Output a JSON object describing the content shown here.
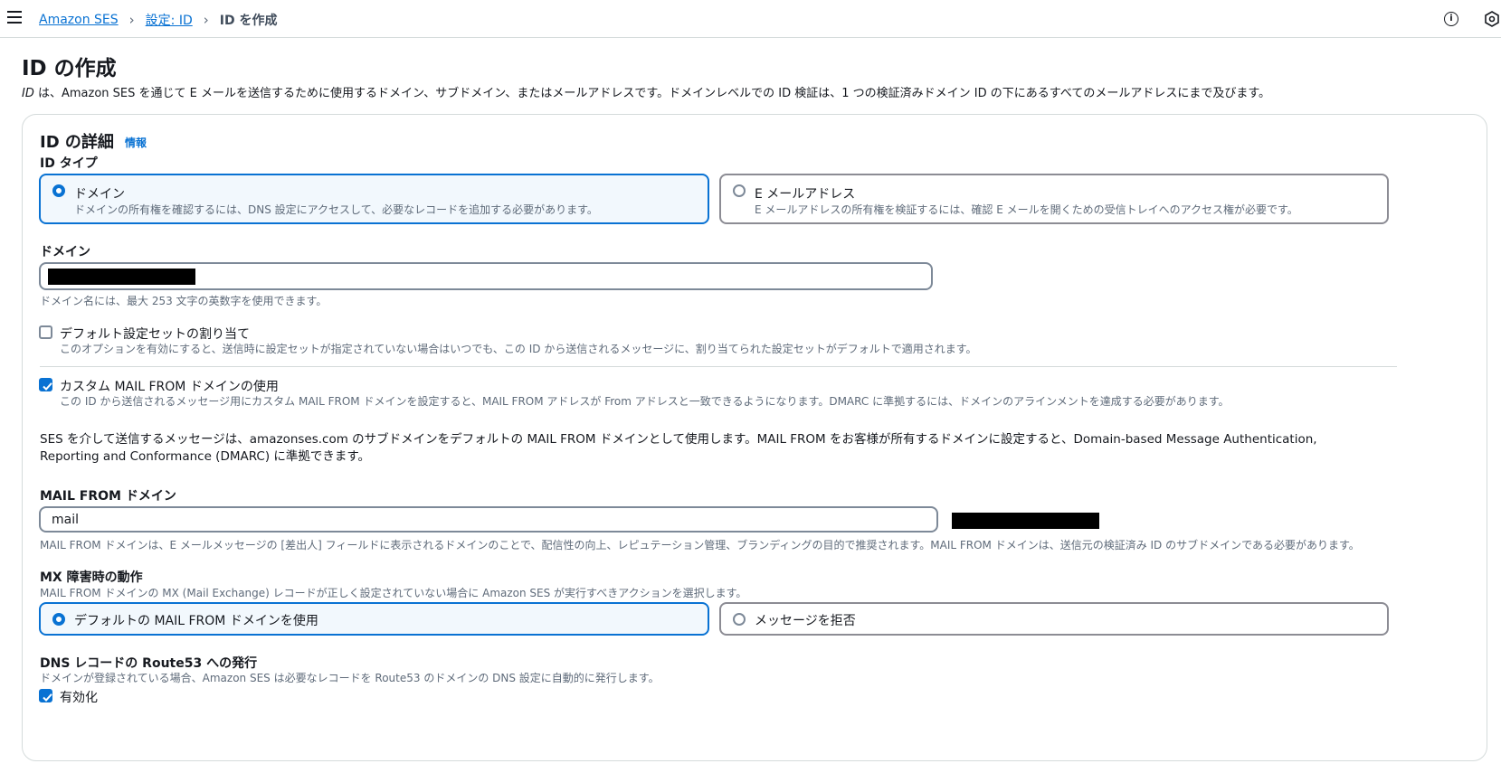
{
  "breadcrumb": {
    "items": [
      "Amazon SES",
      "設定: ID"
    ],
    "current": "ID を作成"
  },
  "icons": {
    "menu": "hamburger-icon",
    "info": "info-icon",
    "settings": "hexagon-icon"
  },
  "header": {
    "title": "ID の作成",
    "desc_em": "ID",
    "desc_rest": " は、Amazon SES を通じて E メールを送信するために使用するドメイン、サブドメイン、またはメールアドレスです。ドメインレベルでの ID 検証は、1 つの検証済みドメイン ID の下にあるすべてのメールアドレスにまで及びます。"
  },
  "details": {
    "title": "ID の詳細",
    "info_link": "情報",
    "id_type_label": "ID タイプ",
    "options": [
      {
        "title": "ドメイン",
        "desc": "ドメインの所有権を確認するには、DNS 設定にアクセスして、必要なレコードを追加する必要があります。",
        "selected": true
      },
      {
        "title": "E メールアドレス",
        "desc": "E メールアドレスの所有権を検証するには、確認 E メールを開くための受信トレイへのアクセス権が必要です。",
        "selected": false
      }
    ],
    "domain_label": "ドメイン",
    "domain_value": "",
    "domain_hint": "ドメイン名には、最大 253 文字の英数字を使用できます。",
    "default_config": {
      "label": "デフォルト設定セットの割り当て",
      "desc": "このオプションを有効にすると、送信時に設定セットが指定されていない場合はいつでも、この ID から送信されるメッセージに、割り当てられた設定セットがデフォルトで適用されます。",
      "checked": false
    },
    "custom_mail_from": {
      "label": "カスタム MAIL FROM ドメインの使用",
      "desc": "この ID から送信されるメッセージ用にカスタム MAIL FROM ドメインを設定すると、MAIL FROM アドレスが From アドレスと一致できるようになります。DMARC に準拠するには、ドメインのアラインメントを達成する必要があります。",
      "checked": true
    },
    "ses_paragraph": "SES を介して送信するメッセージは、amazonses.com のサブドメインをデフォルトの MAIL FROM ドメインとして使用します。MAIL FROM をお客様が所有するドメインに設定すると、Domain-based Message Authentication, Reporting and Conformance (DMARC) に準拠できます。",
    "mail_from_label": "MAIL FROM ドメイン",
    "mail_from_value": "mail",
    "mail_from_hint": "MAIL FROM ドメインは、E メールメッセージの [差出人] フィールドに表示されるドメインのことで、配信性の向上、レピュテーション管理、ブランディングの目的で推奨されます。MAIL FROM ドメインは、送信元の検証済み ID のサブドメインである必要があります。",
    "mx_label": "MX 障害時の動作",
    "mx_desc": "MAIL FROM ドメインの MX (Mail Exchange) レコードが正しく設定されていない場合に Amazon SES が実行すべきアクションを選択します。",
    "mx_options": [
      {
        "title": "デフォルトの MAIL FROM ドメインを使用",
        "selected": true
      },
      {
        "title": "メッセージを拒否",
        "selected": false
      }
    ],
    "route53_label": "DNS レコードの Route53 への発行",
    "route53_desc": "ドメインが登録されている場合、Amazon SES は必要なレコードを Route53 のドメインの DNS 設定に自動的に発行します。",
    "route53_checkbox": "有効化",
    "route53_checked": true
  },
  "colors": {
    "accent": "#0972d3",
    "selected_bg": "#f2f8fd",
    "border": "#8c8c94",
    "hint": "#5f6b7a"
  }
}
